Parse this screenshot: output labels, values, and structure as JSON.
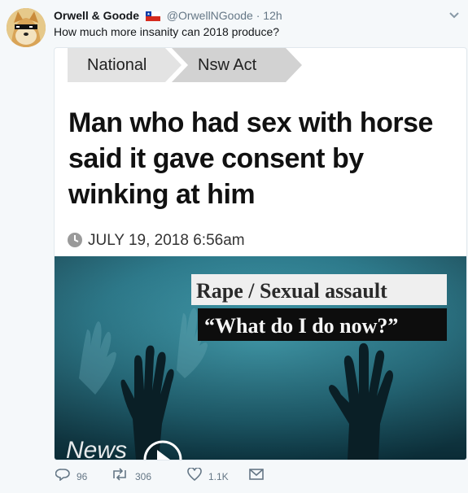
{
  "tweet": {
    "author_name": "Orwell & Goode",
    "handle": "@OrwellNGoode",
    "separator": "·",
    "time": "12h",
    "text": "How much more insanity can 2018 produce?"
  },
  "card": {
    "breadcrumbs": [
      "National",
      "Nsw Act"
    ],
    "headline": "Man who had sex with horse said it gave consent by winking at him",
    "date": "JULY 19, 2018 6:56am",
    "image_caption_line1": "Rape / Sexual assault",
    "image_caption_line2": "“What do I do now?”",
    "image_logo": "News"
  },
  "actions": {
    "replies": "96",
    "retweets": "306",
    "likes": "1.1K"
  },
  "colors": {
    "accent": "#1da1f2",
    "muted": "#657786",
    "image_bg": "#1d6678"
  },
  "icons": {
    "reply": "reply-icon",
    "retweet": "retweet-icon",
    "like": "heart-icon",
    "dm": "envelope-icon",
    "menu": "chevron-down-icon",
    "flag": "chile-flag-icon",
    "clock": "clock-icon",
    "play": "play-icon"
  }
}
